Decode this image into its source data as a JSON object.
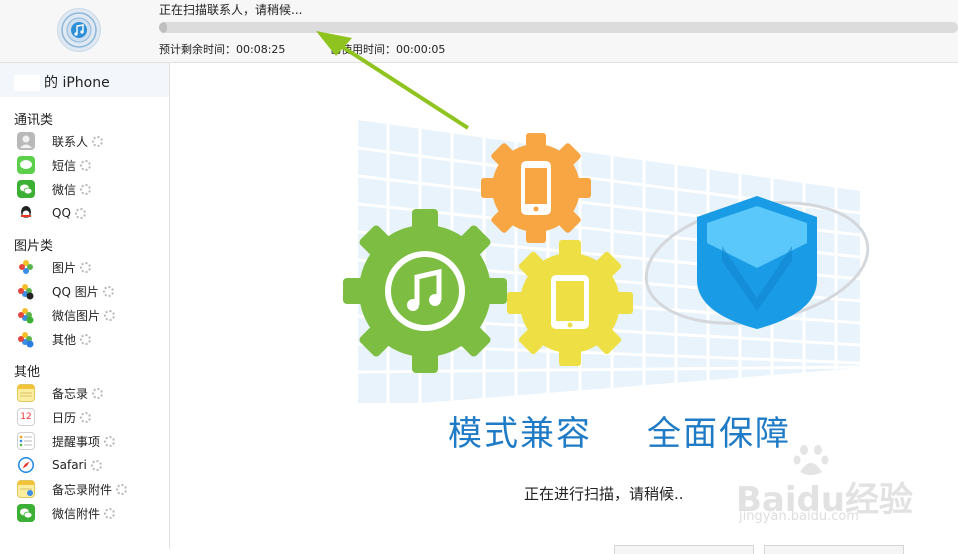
{
  "header": {
    "scan_status": "正在扫描联系人，请稍候...",
    "progress": 0.01,
    "time_remaining": "预计剩余时间：00:08:25",
    "time_elapsed": "已使用时间：00:00:05"
  },
  "sidebar": {
    "device_name": "的 iPhone",
    "groups": [
      {
        "label": "通讯类",
        "items": [
          {
            "label": "联系人",
            "icon": "contacts-icon"
          },
          {
            "label": "短信",
            "icon": "messages-icon"
          },
          {
            "label": "微信",
            "icon": "wechat-icon"
          },
          {
            "label": "QQ",
            "icon": "qq-icon"
          }
        ]
      },
      {
        "label": "图片类",
        "items": [
          {
            "label": "图片",
            "icon": "photos-icon"
          },
          {
            "label": "QQ 图片",
            "icon": "qq-photos-icon"
          },
          {
            "label": "微信图片",
            "icon": "wechat-photos-icon"
          },
          {
            "label": "其他",
            "icon": "other-photos-icon"
          }
        ]
      },
      {
        "label": "其他",
        "items": [
          {
            "label": "备忘录",
            "icon": "notes-icon"
          },
          {
            "label": "日历",
            "icon": "calendar-icon"
          },
          {
            "label": "提醒事项",
            "icon": "reminders-icon"
          },
          {
            "label": "Safari",
            "icon": "safari-icon"
          },
          {
            "label": "备忘录附件",
            "icon": "notes-attachment-icon"
          },
          {
            "label": "微信附件",
            "icon": "wechat-attachment-icon"
          }
        ]
      }
    ],
    "calendar_day": "12"
  },
  "main": {
    "slogan_left": "模式兼容",
    "slogan_right": "全面保障",
    "scan_message": "正在进行扫描，请稍候..",
    "watermark": "Baidu经验",
    "watermark_sub": "jingyan.baidu.com"
  },
  "colors": {
    "accent": "#1f7bc6",
    "gear_green": "#7cbd42",
    "gear_orange": "#f7a643",
    "gear_yellow": "#eedf45",
    "shield_blue": "#1a9be6",
    "arrow_green": "#8fc31f"
  }
}
